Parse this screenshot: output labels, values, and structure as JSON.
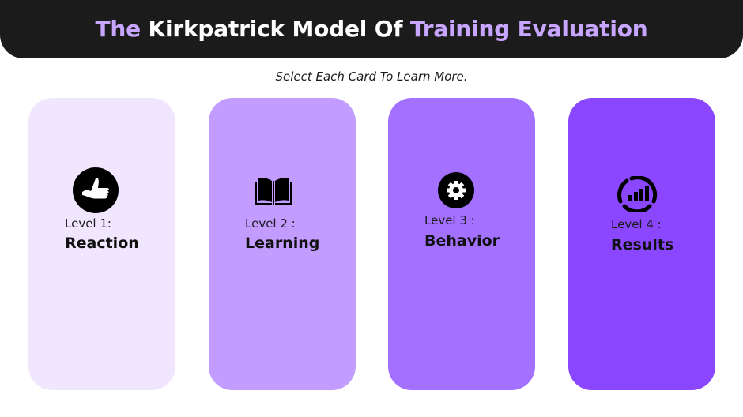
{
  "header": {
    "title_part1": "The",
    "title_part2": "Kirkpatrick Model Of",
    "title_part3": "Training Evaluation"
  },
  "subtitle": "Select Each Card To Learn More.",
  "colors": {
    "header_bg": "#1c1b1c",
    "title_accent": "#c8a6ff",
    "title_white": "#ffffff",
    "card_1": "#f0e7ff",
    "card_2": "#c39cff",
    "card_3": "#a370ff",
    "card_4": "#8a47ff"
  },
  "cards": [
    {
      "level": "Level 1:",
      "name": "Reaction",
      "icon": "thumbs-up-icon"
    },
    {
      "level": "Level 2 :",
      "name": "Learning",
      "icon": "open-book-icon"
    },
    {
      "level": "Level 3 :",
      "name": "Behavior",
      "icon": "gear-icon"
    },
    {
      "level": "Level 4 :",
      "name": "Results",
      "icon": "results-chart-icon"
    }
  ]
}
